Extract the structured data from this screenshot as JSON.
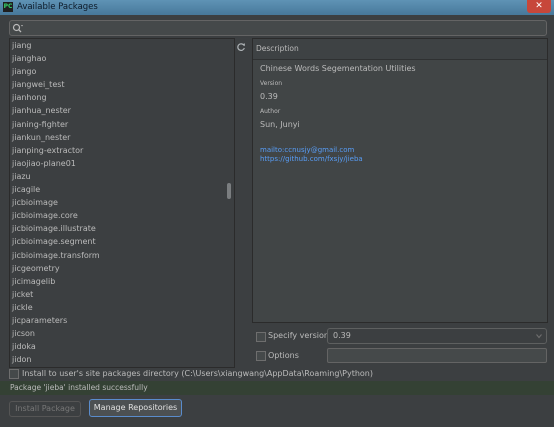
{
  "window": {
    "title": "Available Packages",
    "app_icon_text": "PC",
    "close_symbol": "✕"
  },
  "search": {
    "value": "",
    "placeholder": ""
  },
  "packages": [
    "jiang",
    "jianghao",
    "jiango",
    "jiangwei_test",
    "jianhong",
    "jianhua_nester",
    "jianing-fighter",
    "jiankun_nester",
    "jianping-extractor",
    "jiaojiao-plane01",
    "jiazu",
    "jicagile",
    "jicbioimage",
    "jicbioimage.core",
    "jicbioimage.illustrate",
    "jicbioimage.segment",
    "jicbioimage.transform",
    "jicgeometry",
    "jicimagelib",
    "jicket",
    "jickle",
    "jicparameters",
    "jicson",
    "jidoka",
    "jidon"
  ],
  "description": {
    "header": "Description",
    "summary": "Chinese Words Segementation Utilities",
    "version_label": "Version",
    "version": "0.39",
    "author_label": "Author",
    "author": "Sun, Junyi",
    "mailto": "mailto:ccnusjy@gmail.com",
    "homepage": "https://github.com/fxsjy/jieba"
  },
  "options": {
    "specify_version_label": "Specify version",
    "specify_version_checked": false,
    "version_value": "0.39",
    "options_label": "Options",
    "options_checked": false,
    "options_value": ""
  },
  "install_user_site_label": "Install to user's site packages directory (C:\\Users\\xiangwang\\AppData\\Roaming\\Python)",
  "status_message": "Package 'jieba' installed successfully",
  "buttons": {
    "install": "Install Package",
    "manage": "Manage Repositories"
  },
  "colors": {
    "background": "#3c3f41",
    "link": "#589df6",
    "status_bg": "#344134",
    "title_bar": "#5f93b5",
    "close": "#c7473a"
  }
}
